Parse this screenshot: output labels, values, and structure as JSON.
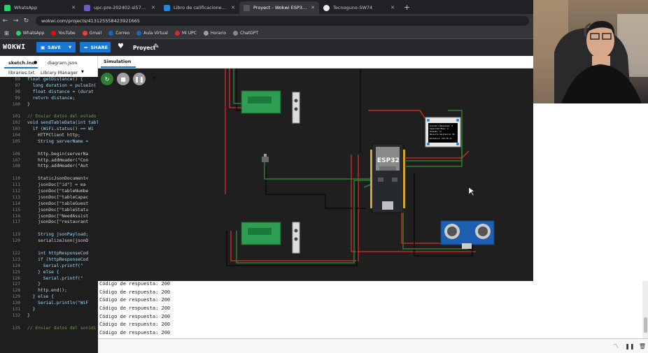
{
  "browser": {
    "tabs": [
      {
        "title": "WhatsApp",
        "color": "#25d366"
      },
      {
        "title": "upc-pre-202402-si572-sw74-lo",
        "color": "#6a5acd"
      },
      {
        "title": "Libro de calificaciones / Taller d",
        "color": "#1e88e5"
      },
      {
        "title": "Proyect - Wokwi ESP32, STM32,",
        "color": "#444",
        "active": true
      },
      {
        "title": "Tecnoguno-SW74",
        "color": "#222"
      }
    ],
    "new_tab": "+",
    "url": "wokwi.com/projects/413125558423921665",
    "bookmarks": [
      {
        "label": "WhatsApp",
        "color": "#25d366"
      },
      {
        "label": "YouTube",
        "color": "#ff0000"
      },
      {
        "label": "Gmail",
        "color": "#ea4335"
      },
      {
        "label": "Correo",
        "color": "#1565c0"
      },
      {
        "label": "Aula Virtual",
        "color": "#1565c0"
      },
      {
        "label": "Mi UPC",
        "color": "#d32f2f"
      },
      {
        "label": "Horario",
        "color": "#9e9e9e"
      },
      {
        "label": "ChatGPT",
        "color": "#888888"
      }
    ]
  },
  "wokwi": {
    "logo": "WOKWI",
    "save": "SAVE",
    "share": "SHARE",
    "project": "Proyect",
    "accent": "#1976d2"
  },
  "editor": {
    "tabs": [
      "sketch.ino",
      "diagram.json",
      "libraries.txt",
      "Library Manager"
    ],
    "lines": [
      {
        "n": "89",
        "t": "float getDistance() {"
      },
      {
        "n": "97",
        "t": "  long duration = pulseIn("
      },
      {
        "n": "98",
        "t": "  float distance = (durat"
      },
      {
        "n": "99",
        "t": "  return distance;"
      },
      {
        "n": "100",
        "t": "}"
      },
      {
        "n": "",
        "t": ""
      },
      {
        "n": "101",
        "t": "// Enviar datos del estado"
      },
      {
        "n": "102",
        "t": "void sendTableData(int tabl"
      },
      {
        "n": "103",
        "t": "  if (WiFi.status() == Wi"
      },
      {
        "n": "104",
        "t": "    HTTPClient http;"
      },
      {
        "n": "105",
        "t": "    String serverName ="
      },
      {
        "n": "",
        "t": ""
      },
      {
        "n": "106",
        "t": "    http.begin(serverNa"
      },
      {
        "n": "107",
        "t": "    http.addHeader(\"Con"
      },
      {
        "n": "108",
        "t": "    http.addHeader(\"Aut"
      },
      {
        "n": "",
        "t": ""
      },
      {
        "n": "110",
        "t": "    StaticJsonDocument<"
      },
      {
        "n": "111",
        "t": "    jsonDoc[\"id\"] = ea"
      },
      {
        "n": "112",
        "t": "    jsonDoc[\"tableNumbe"
      },
      {
        "n": "113",
        "t": "    jsonDoc[\"tableCapac"
      },
      {
        "n": "114",
        "t": "    jsonDoc[\"tableGuest"
      },
      {
        "n": "115",
        "t": "    jsonDoc[\"tableStatu"
      },
      {
        "n": "116",
        "t": "    jsonDoc[\"NeedAssist"
      },
      {
        "n": "117",
        "t": "    jsonDoc[\"restaurant"
      },
      {
        "n": "",
        "t": ""
      },
      {
        "n": "119",
        "t": "    String jsonPayload;"
      },
      {
        "n": "120",
        "t": "    serializeJson(jsonD"
      },
      {
        "n": "",
        "t": ""
      },
      {
        "n": "122",
        "t": "    int httpResponseCod"
      },
      {
        "n": "123",
        "t": "    if (httpResponseCod"
      },
      {
        "n": "124",
        "t": "      Serial.printf(\""
      },
      {
        "n": "125",
        "t": "    } else {"
      },
      {
        "n": "126",
        "t": "      Serial.printf(\""
      },
      {
        "n": "127",
        "t": "    }"
      },
      {
        "n": "128",
        "t": "    http.end();"
      },
      {
        "n": "129",
        "t": "  } else {"
      },
      {
        "n": "130",
        "t": "    Serial.println(\"WiF"
      },
      {
        "n": "131",
        "t": "  }"
      },
      {
        "n": "132",
        "t": "}"
      },
      {
        "n": "",
        "t": ""
      },
      {
        "n": "135",
        "t": "// Enviar datos del sonidi"
      }
    ]
  },
  "simulation": {
    "tab": "Simulation",
    "esp_label": "ESP32",
    "oled_text": [
      "Ingrese Comensales: 4",
      "Capacidad Mesa: 4",
      "Ocupado: Si",
      "Necesita Asistencia: No",
      "Distancia: 273.28 cm"
    ]
  },
  "serial": {
    "lines": [
      "Código de respuesta: 200",
      "Código de respuesta: 200",
      "Código de respuesta: 200",
      "Código de respuesta: 200",
      "Código de respuesta: 200",
      "Código de respuesta: 200",
      "Código de respuesta: 200"
    ]
  }
}
